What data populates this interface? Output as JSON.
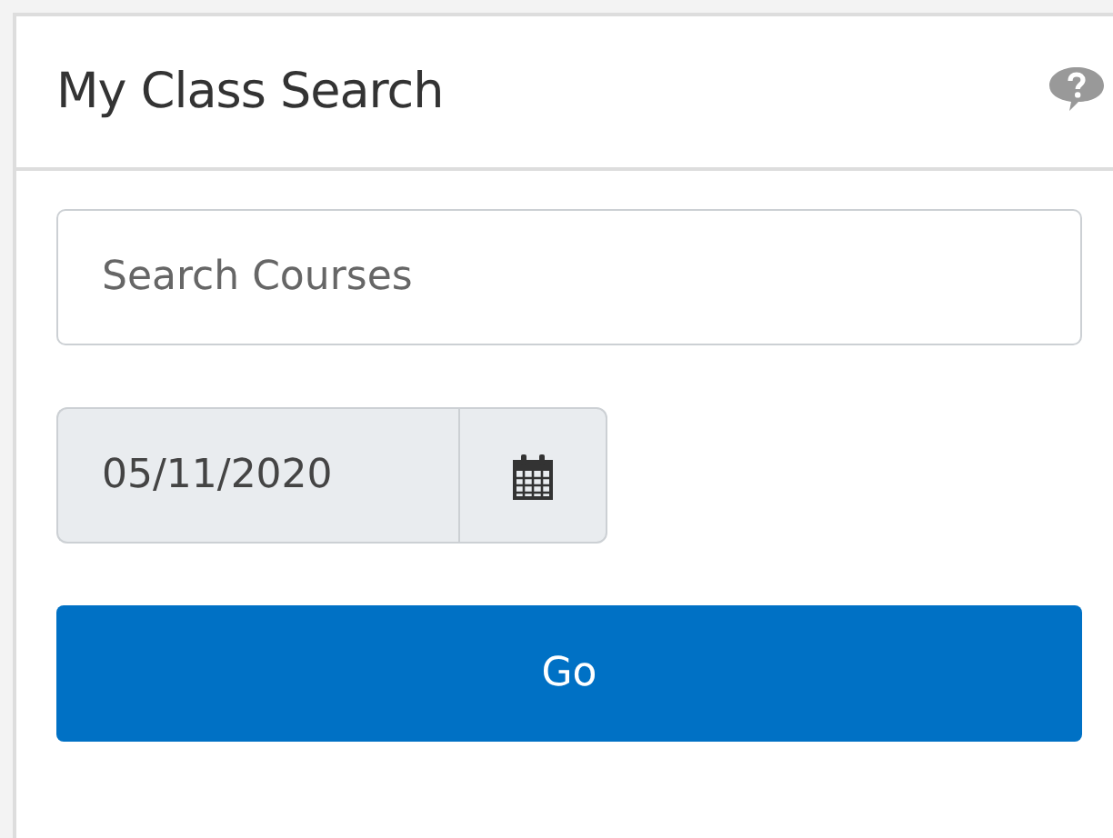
{
  "panel": {
    "title": "My Class Search"
  },
  "search": {
    "placeholder": "Search Courses"
  },
  "date": {
    "value": "05/11/2020",
    "disabled": true
  },
  "buttons": [
    {
      "label": "Go",
      "kind": "primary"
    }
  ]
}
